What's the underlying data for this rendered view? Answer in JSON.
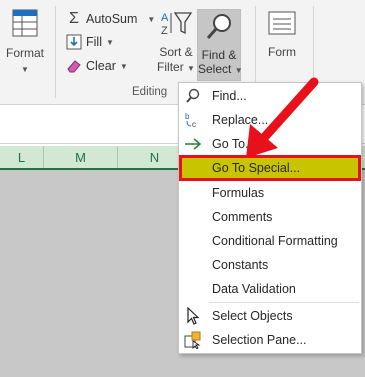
{
  "ribbon": {
    "format_label": "Format",
    "autosum_label": "AutoSum",
    "fill_label": "Fill",
    "clear_label": "Clear",
    "sort_filter_line1": "Sort &",
    "sort_filter_line2": "Filter",
    "find_select_line1": "Find &",
    "find_select_line2": "Select",
    "form_label": "Form",
    "editing_group_label": "Editing"
  },
  "columns": [
    "L",
    "M",
    "N"
  ],
  "menu": {
    "items": [
      {
        "label": "Find...",
        "icon": "magnifier-icon"
      },
      {
        "label": "Replace...",
        "icon": "replace-icon"
      },
      {
        "label": "Go To...",
        "icon": "arrow-right-icon"
      },
      {
        "label": "Go To Special...",
        "icon": ""
      },
      {
        "label": "Formulas",
        "icon": ""
      },
      {
        "label": "Comments",
        "icon": ""
      },
      {
        "label": "Conditional Formatting",
        "icon": ""
      },
      {
        "label": "Constants",
        "icon": ""
      },
      {
        "label": "Data Validation",
        "icon": ""
      },
      {
        "label": "Select Objects",
        "icon": "pointer-arrow-icon"
      },
      {
        "label": "Selection Pane...",
        "icon": "selection-pane-icon"
      }
    ]
  },
  "colors": {
    "highlight_fill": "#c8c400",
    "highlight_border": "#e8111b",
    "annotation_arrow": "#e8111b",
    "column_header_bg": "#d3e8d3",
    "accent_green": "#217346"
  }
}
